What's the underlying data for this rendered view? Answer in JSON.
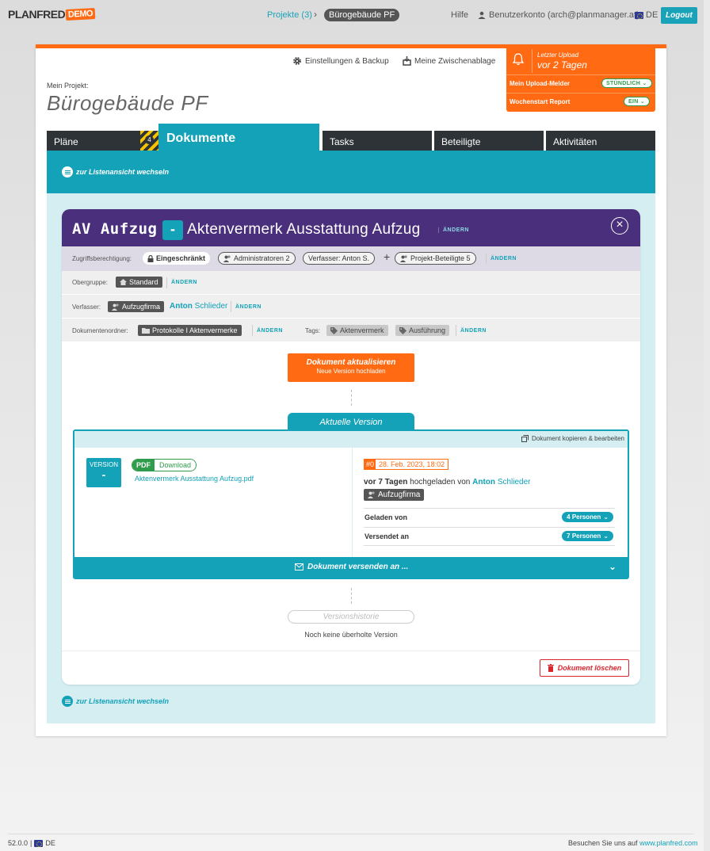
{
  "brand": {
    "name": "PLANFRED",
    "badge": "DEMO"
  },
  "topnav": {
    "projects": "Projekte (3)",
    "current_project": "Bürogebäude PF",
    "help": "Hilfe",
    "account": "Benutzerkonto (arch@planmanager.at)",
    "language": "DE",
    "logout": "Logout"
  },
  "toolbar": {
    "settings": "Einstellungen & Backup",
    "clipboard": "Meine Zwischenablage"
  },
  "upload_notice": {
    "last_upload_label": "Letzter Upload",
    "last_upload_value": "vor 2 Tagen",
    "upload_alert_label": "Mein Upload-Melder",
    "upload_alert_value": "STÜNDLICH",
    "weekly_report_label": "Wochenstart Report",
    "weekly_report_value": "EIN"
  },
  "project": {
    "label": "Mein Projekt:",
    "title": "Bürogebäude PF"
  },
  "tabs": [
    {
      "label": "Pläne",
      "badge": "4"
    },
    {
      "label": "Dokumente"
    },
    {
      "label": "Tasks"
    },
    {
      "label": "Beteiligte"
    },
    {
      "label": "Aktivitäten"
    }
  ],
  "list_view_link": "zur Listenansicht wechseln",
  "document": {
    "code": "AV Aufzug",
    "index": "-",
    "name": "Aktenvermerk Ausstattung Aufzug",
    "change": "ÄNDERN",
    "access": {
      "label": "Zugriffsberechtigung:",
      "level": "Eingeschränkt",
      "admins": "Administratoren 2",
      "author": "Verfasser: Anton S.",
      "plus": "+",
      "members": "Projekt-Beteiligte 5"
    },
    "parent_group": {
      "label": "Obergruppe:",
      "value": "Standard"
    },
    "author": {
      "label": "Verfasser:",
      "company": "Aufzugfirma",
      "first": "Anton",
      "last": "Schlieder"
    },
    "folder": {
      "label": "Dokumentenordner:",
      "value": "Protokolle I Aktenvermerke"
    },
    "tags": {
      "label": "Tags:",
      "items": [
        "Aktenvermerk",
        "Ausführung"
      ]
    },
    "update_button": {
      "title": "Dokument aktualisieren",
      "subtitle": "Neue Version hochladen"
    },
    "current_version": {
      "tab": "Aktuelle Version",
      "copy_edit": "Dokument kopieren & bearbeiten",
      "version_label": "VERSION",
      "version_value": "-",
      "file_type": "PDF",
      "download": "Download",
      "file_name": "Aktenvermerk Ausstattung Aufzug.pdf",
      "revision": "#0",
      "date": "28. Feb. 2023, 18:02",
      "uploaded_when": "vor 7 Tagen",
      "uploaded_text": "hochgeladen von",
      "uploader_first": "Anton",
      "uploader_last": "Schlieder",
      "uploader_company": "Aufzugfirma",
      "loaded_by_label": "Geladen von",
      "loaded_by_value": "4 Personen",
      "sent_to_label": "Versendet an",
      "sent_to_value": "7 Personen",
      "send_action": "Dokument versenden an ..."
    },
    "history": {
      "label": "Versionshistorie",
      "empty": "Noch keine überholte Version"
    },
    "delete": "Dokument löschen"
  },
  "footer": {
    "version": "52.0.0",
    "separator": "|",
    "language": "DE",
    "visit_text": "Besuchen Sie uns auf",
    "visit_link": "www.planfred.com"
  },
  "colors": {
    "accent": "#13a2b8",
    "brand": "#ff6a13",
    "header": "#4a2f7c",
    "danger": "#d9262e",
    "success": "#2e9c4a"
  }
}
